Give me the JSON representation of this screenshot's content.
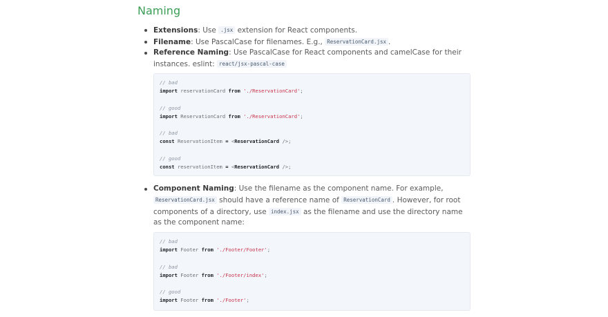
{
  "heading": "Naming",
  "bullets": [
    {
      "term": "Extensions",
      "pre": ": Use ",
      "code": ".jsx",
      "post": " extension for React components."
    },
    {
      "term": "Filename",
      "pre": ": Use PascalCase for filenames. E.g., ",
      "code": "ReservationCard.jsx",
      "post": "."
    },
    {
      "term": "Reference Naming",
      "pre": ": Use PascalCase for React components and camelCase for their instances. eslint: ",
      "code": "react/jsx-pascal-case",
      "post": ""
    }
  ],
  "code1": {
    "c1": "// bad",
    "l1": {
      "kw1": "import",
      "ident": " reservationCard ",
      "kw2": "from",
      "str": " './ReservationCard'",
      "end": ";"
    },
    "c2": "// good",
    "l2": {
      "kw1": "import",
      "ident": " ReservationCard ",
      "kw2": "from",
      "str": " './ReservationCard'",
      "end": ";"
    },
    "c3": "// bad",
    "l3": {
      "kw1": "const",
      "ident": " ReservationItem ",
      "eq": "=",
      "rest1": " <",
      "tag": "ReservationCard",
      "rest2": " />;"
    },
    "c4": "// good",
    "l4": {
      "kw1": "const",
      "ident": " reservationItem ",
      "eq": "=",
      "rest1": " <",
      "tag": "ReservationCard",
      "rest2": " />;"
    }
  },
  "component_naming": {
    "term": "Component Naming",
    "t1": ": Use the filename as the component name. For example, ",
    "code1": "ReservationCard.jsx",
    "t2": " should have a reference name of ",
    "code2": "ReservationCard",
    "t3": ". However, for root components of a directory, use ",
    "code3": "index.jsx",
    "t4": " as the filename and use the directory name as the component name:"
  },
  "code2": {
    "c1": "// bad",
    "l1": {
      "kw1": "import",
      "ident": " Footer ",
      "kw2": "from",
      "str": " './Footer/Footer'",
      "end": ";"
    },
    "c2": "// bad",
    "l2": {
      "kw1": "import",
      "ident": " Footer ",
      "kw2": "from",
      "str": " './Footer/index'",
      "end": ";"
    },
    "c3": "// good",
    "l3": {
      "kw1": "import",
      "ident": " Footer ",
      "kw2": "from",
      "str": " './Footer'",
      "end": ";"
    }
  }
}
